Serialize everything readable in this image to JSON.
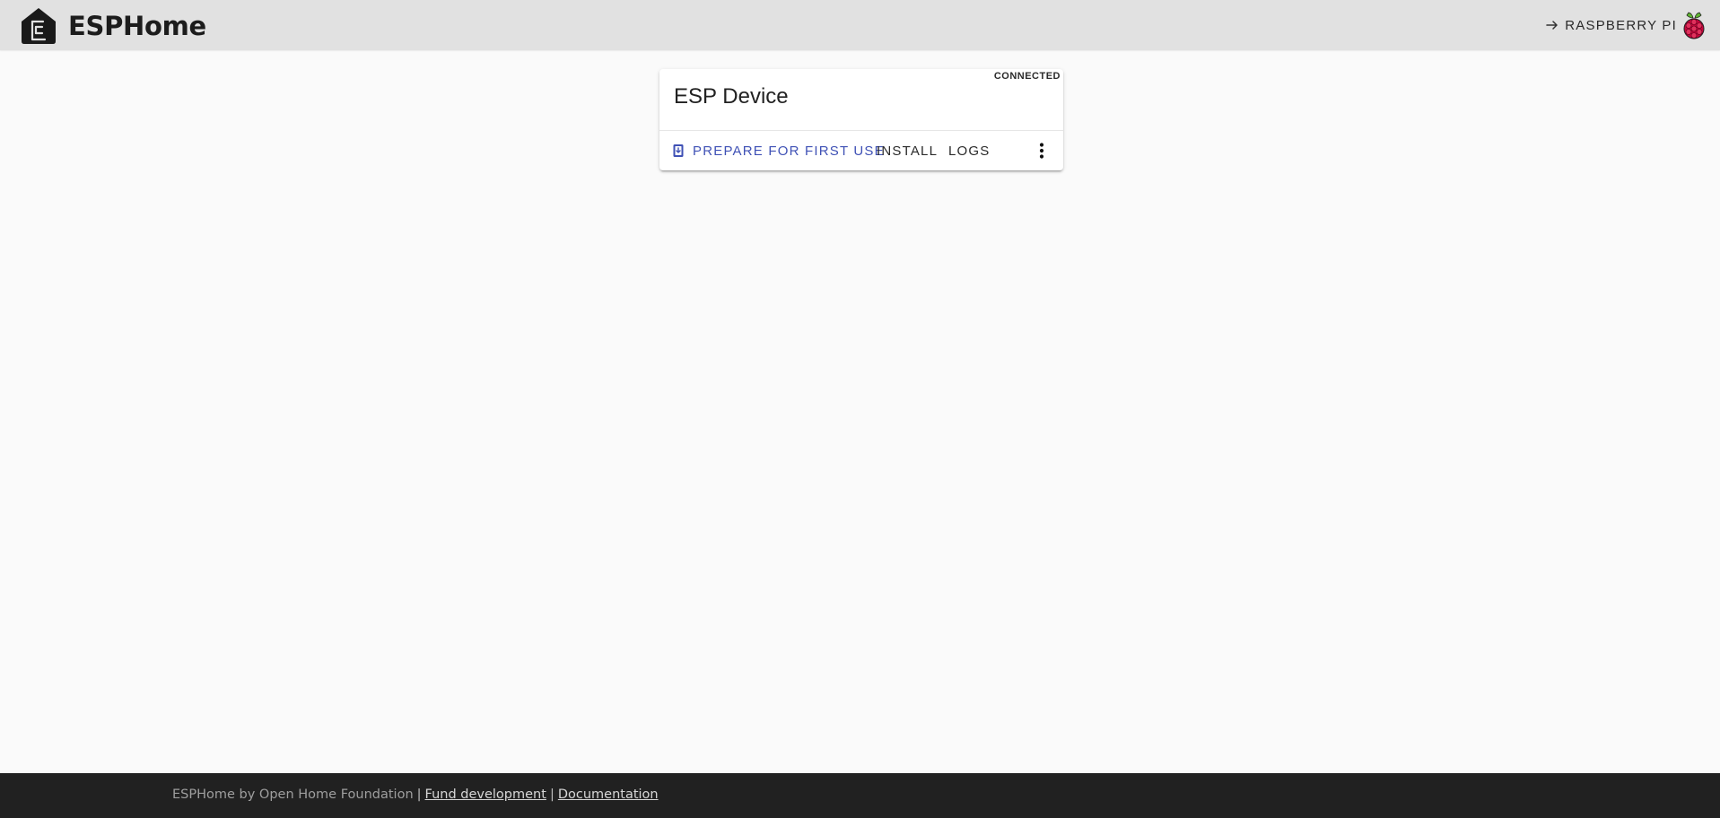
{
  "header": {
    "brand": "ESPHome",
    "logo_icon": "esphome-logo-icon",
    "platform_label": "RASPBERRY PI",
    "platform_arrow_icon": "arrow-right-icon",
    "platform_icon": "raspberry-pi-icon"
  },
  "device_card": {
    "status": "CONNECTED",
    "title": "ESP Device",
    "actions": {
      "prepare_label": "PREPARE FOR FIRST USE",
      "prepare_icon": "device-download-icon",
      "install_label": "INSTALL",
      "logs_label": "LOGS",
      "menu_icon": "more-vert-icon"
    }
  },
  "footer": {
    "credit": "ESPHome by Open Home Foundation",
    "separator": "|",
    "fund_link": "Fund development",
    "docs_link": "Documentation"
  },
  "colors": {
    "header_bg": "#e1e1e1",
    "page_bg": "#fafafa",
    "accent": "#3f51b5",
    "footer_bg": "#212121"
  }
}
